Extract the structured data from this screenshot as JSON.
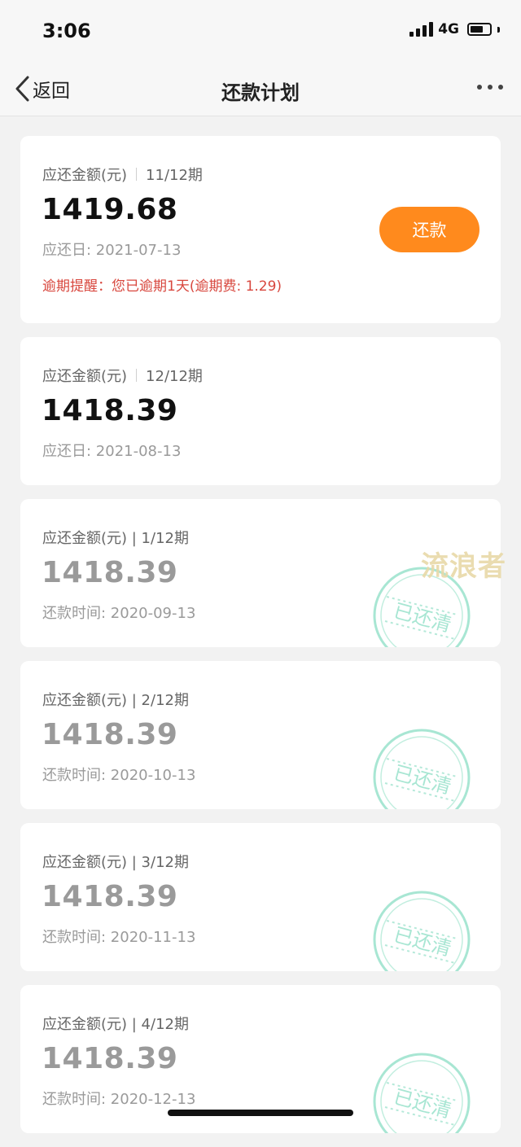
{
  "status": {
    "time": "3:06",
    "network": "4G"
  },
  "nav": {
    "back_label": "返回",
    "title": "还款计划"
  },
  "cards": [
    {
      "label": "应还金额(元)",
      "period": "11/12期",
      "amount": "1419.68",
      "date": "应还日: 2021-07-13",
      "overdue": "逾期提醒：您已逾期1天(逾期费: 1.29)",
      "button": "还款",
      "paid": false
    },
    {
      "label": "应还金额(元)",
      "period": "12/12期",
      "amount": "1418.39",
      "date": "应还日: 2021-08-13",
      "paid": false
    },
    {
      "label": "应还金额(元) | 1/12期",
      "amount": "1418.39",
      "date": "还款时间: 2020-09-13",
      "paid": true,
      "stamp": "已还清"
    },
    {
      "label": "应还金额(元) | 2/12期",
      "amount": "1418.39",
      "date": "还款时间: 2020-10-13",
      "paid": true,
      "stamp": "已还清"
    },
    {
      "label": "应还金额(元) | 3/12期",
      "amount": "1418.39",
      "date": "还款时间: 2020-11-13",
      "paid": true,
      "stamp": "已还清"
    },
    {
      "label": "应还金额(元) | 4/12期",
      "amount": "1418.39",
      "date": "还款时间: 2020-12-13",
      "paid": true,
      "stamp": "已还清"
    }
  ],
  "watermark": "流浪者",
  "colors": {
    "accent": "#ff8a1d",
    "overdue": "#d8473e",
    "stamp": "#9fe3cf"
  }
}
